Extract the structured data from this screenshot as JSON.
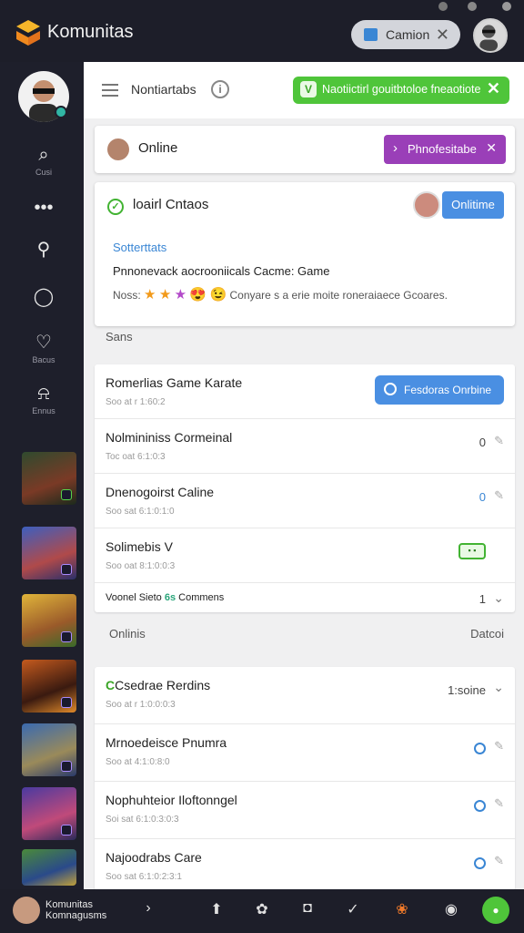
{
  "app": {
    "title": "Komunitas"
  },
  "topbar": {
    "chip_label": "Camion",
    "chip_close": "✕"
  },
  "sidebar": {
    "nav": [
      {
        "icon": "search-icon",
        "glyph": "⌕",
        "label": "Cusi"
      },
      {
        "icon": "more-icon",
        "glyph": "•••",
        "label": ""
      },
      {
        "icon": "pin-icon",
        "glyph": "⚲",
        "label": ""
      },
      {
        "icon": "chat-icon",
        "glyph": "◯",
        "label": ""
      },
      {
        "icon": "shield-icon",
        "glyph": "♡",
        "label": "Bacus"
      },
      {
        "icon": "bell-icon",
        "glyph": "⍾",
        "label": "Ennus"
      }
    ]
  },
  "header": {
    "title": "Nontiartabs",
    "info_glyph": "i",
    "notice_text": "Naotiictirl gouitbtoloe fneaotiote",
    "notice_close": "✕"
  },
  "status_card": {
    "label": "Online",
    "button_label": "Phnofesitabe",
    "button_arrow": "›",
    "button_close": "✕"
  },
  "info_card": {
    "title": "loairl Cntaos",
    "button_label": "Onlitime",
    "subtitle": "Sotterttats",
    "description": "Pnnonevack aocrooniicals Cacme: Game",
    "rating_label": "Noss:",
    "stars": [
      "★",
      "★",
      "★",
      "😍",
      "😉"
    ],
    "rating_text": "Conyare s a erie moite roneraiaece Gcoares."
  },
  "section1": {
    "label": "Sans"
  },
  "list1": {
    "rows": [
      {
        "title": "Romerlias Game Karate",
        "sub": "Soo at r 1:60:2",
        "button_label": "Fesdoras Onrbine"
      },
      {
        "title": "Nolmininiss Cormeinal",
        "sub": "Toc oat 6:1:0:3",
        "num": "0"
      },
      {
        "title": "Dnenogoirst Caline",
        "sub": "Soo sat 6:1:0:1:0",
        "num": "0"
      },
      {
        "title": "Solimebis V",
        "sub": "Soo oat 8:1:0:0:3",
        "toggle": "▪ ▪"
      },
      {
        "title": "Voonel Sieto",
        "badge": "6s",
        "extra": "Commens",
        "num": "1"
      }
    ]
  },
  "section2": {
    "left": "Onlinis",
    "right": "Datcoi"
  },
  "list2": {
    "rows": [
      {
        "title": "Csedrae Rerdins",
        "sub": "Soo at r 1:0:0:0:3",
        "num": "1:soine"
      },
      {
        "title": "Mrnoedeisce Pnumra",
        "sub": "Soo at 4:1:0:8:0"
      },
      {
        "title": "Nophuhteior Iloftonngel",
        "sub": "Soi sat 6:1:0:3:0:3"
      },
      {
        "title": "Najoodrabs Care",
        "sub": "Soo sat 6:1:0:2:3:1"
      }
    ]
  },
  "bottombar": {
    "username": "Komunitas",
    "handle": "Komnagusms",
    "icons": [
      "›",
      "⬆",
      "✿",
      "◘",
      "✓",
      "❀",
      "◉"
    ],
    "green": "●"
  },
  "colors": {
    "accent_green": "#4fc53a",
    "accent_blue": "#4a8fe2",
    "accent_purple": "#9a3fb8",
    "dark": "#1e1f2b"
  }
}
